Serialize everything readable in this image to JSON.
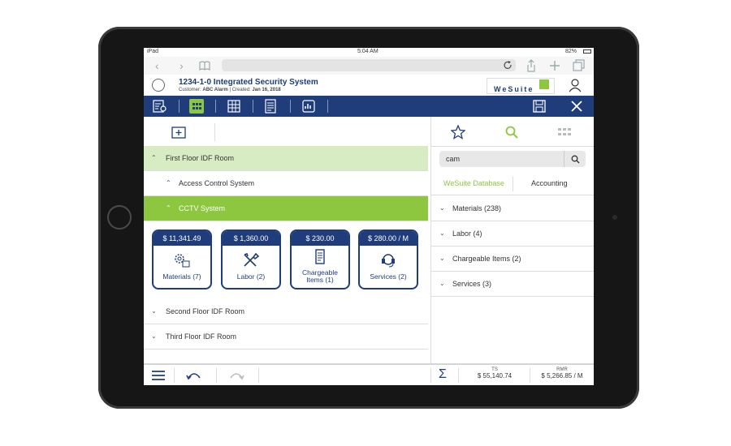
{
  "status": {
    "device": "iPad",
    "time": "5:04 AM",
    "battery": "82%"
  },
  "header": {
    "title": "1234-1-0 Integrated Security System",
    "customer_label": "Customer:",
    "customer": "ABC Alarm",
    "created_label": "Created:",
    "created": "Jan 16, 2018",
    "logo_text": "WeSuite"
  },
  "left": {
    "rows": [
      {
        "label": "First Floor IDF Room"
      },
      {
        "label": "Access Control System"
      },
      {
        "label": "CCTV System"
      }
    ],
    "cards": [
      {
        "price": "$ 11,341.49",
        "label": "Materials (7)"
      },
      {
        "price": "$ 1,360.00",
        "label": "Labor (2)"
      },
      {
        "price": "$ 230.00",
        "label1": "Chargeable",
        "label2": "Items (1)"
      },
      {
        "price": "$ 280.00 / M",
        "label": "Services (2)"
      }
    ],
    "rows_after": [
      {
        "label": "Second Floor IDF Room"
      },
      {
        "label": "Third Floor IDF Room"
      }
    ]
  },
  "right": {
    "search_value": "cam",
    "tabs": [
      {
        "label": "WeSuite Database"
      },
      {
        "label": "Accounting"
      }
    ],
    "results": [
      {
        "label": "Materials (238)"
      },
      {
        "label": "Labor (4)"
      },
      {
        "label": "Chargeable Items (2)"
      },
      {
        "label": "Services  (3)"
      }
    ]
  },
  "totals": {
    "ts_label": "TS",
    "ts_value": "$ 55,140.74",
    "rmr_label": "RMR",
    "rmr_value": "$ 5,266.85 / M"
  },
  "colors": {
    "navy": "#1f3d7a",
    "green": "#8dc63f",
    "light_green": "#d8ecc4"
  }
}
